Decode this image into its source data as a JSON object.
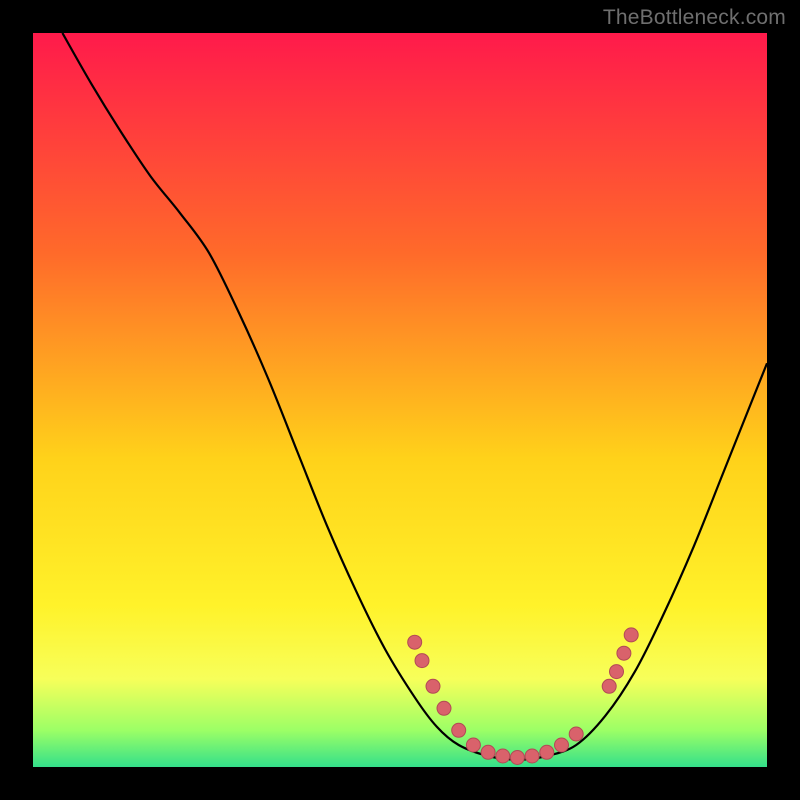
{
  "watermark": "TheBottleneck.com",
  "colors": {
    "bg_black": "#000000",
    "grad_top": "#ff1a4b",
    "grad_mid1": "#ff6a2a",
    "grad_mid2": "#ffd21a",
    "grad_mid3": "#fff22a",
    "grad_bottom_yellow": "#f7ff5a",
    "grad_green1": "#9cff66",
    "grad_green2": "#34e08a",
    "curve_stroke": "#000000",
    "marker_fill": "#d9626b",
    "marker_stroke": "#b24a55",
    "watermark_color": "#6f6f6f"
  },
  "chart_data": {
    "type": "line",
    "title": "",
    "xlabel": "",
    "ylabel": "",
    "xlim": [
      0,
      100
    ],
    "ylim": [
      0,
      100
    ],
    "curve_xy_pct": [
      [
        4.0,
        100.0
      ],
      [
        8.0,
        93.0
      ],
      [
        12.0,
        86.5
      ],
      [
        16.0,
        80.5
      ],
      [
        20.0,
        75.5
      ],
      [
        24.0,
        70.0
      ],
      [
        28.0,
        62.0
      ],
      [
        32.0,
        53.0
      ],
      [
        36.0,
        43.0
      ],
      [
        40.0,
        33.0
      ],
      [
        44.0,
        24.0
      ],
      [
        48.0,
        16.0
      ],
      [
        52.0,
        9.5
      ],
      [
        55.0,
        5.5
      ],
      [
        58.0,
        3.0
      ],
      [
        62.0,
        1.5
      ],
      [
        66.0,
        1.0
      ],
      [
        70.0,
        1.5
      ],
      [
        74.0,
        3.0
      ],
      [
        78.0,
        7.0
      ],
      [
        82.0,
        13.0
      ],
      [
        86.0,
        21.0
      ],
      [
        90.0,
        30.0
      ],
      [
        94.0,
        40.0
      ],
      [
        98.0,
        50.0
      ],
      [
        100.0,
        55.0
      ]
    ],
    "markers_xy_pct": [
      [
        52.0,
        17.0
      ],
      [
        53.0,
        14.5
      ],
      [
        54.5,
        11.0
      ],
      [
        56.0,
        8.0
      ],
      [
        58.0,
        5.0
      ],
      [
        60.0,
        3.0
      ],
      [
        62.0,
        2.0
      ],
      [
        64.0,
        1.5
      ],
      [
        66.0,
        1.3
      ],
      [
        68.0,
        1.5
      ],
      [
        70.0,
        2.0
      ],
      [
        72.0,
        3.0
      ],
      [
        74.0,
        4.5
      ],
      [
        78.5,
        11.0
      ],
      [
        79.5,
        13.0
      ],
      [
        80.5,
        15.5
      ],
      [
        81.5,
        18.0
      ]
    ]
  }
}
